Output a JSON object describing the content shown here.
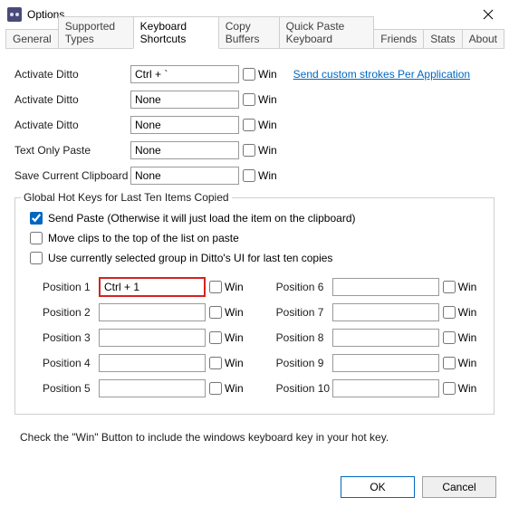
{
  "window": {
    "title": "Options"
  },
  "tabs": [
    {
      "label": "General"
    },
    {
      "label": "Supported Types"
    },
    {
      "label": "Keyboard Shortcuts"
    },
    {
      "label": "Copy Buffers"
    },
    {
      "label": "Quick Paste Keyboard"
    },
    {
      "label": "Friends"
    },
    {
      "label": "Stats"
    },
    {
      "label": "About"
    }
  ],
  "active_tab_index": 2,
  "shortcut_rows": [
    {
      "label": "Activate Ditto",
      "value": "Ctrl + `",
      "win_checked": false
    },
    {
      "label": "Activate Ditto",
      "value": "None",
      "win_checked": false
    },
    {
      "label": "Activate Ditto",
      "value": "None",
      "win_checked": false
    },
    {
      "label": "Text Only Paste",
      "value": "None",
      "win_checked": false
    },
    {
      "label": "Save Current Clipboard",
      "value": "None",
      "win_checked": false
    }
  ],
  "win_label": "Win",
  "link_text": "Send custom strokes Per Application",
  "group": {
    "title": "Global Hot Keys for Last Ten Items Copied",
    "options": [
      {
        "label": "Send Paste (Otherwise it will just load the item on the clipboard)",
        "checked": true
      },
      {
        "label": "Move clips to the top of the list on paste",
        "checked": false
      },
      {
        "label": "Use currently selected group in Ditto's UI for last ten copies",
        "checked": false
      }
    ],
    "positions_left": [
      {
        "label": "Position 1",
        "value": "Ctrl + 1",
        "win_checked": false,
        "highlight": true
      },
      {
        "label": "Position 2",
        "value": "",
        "win_checked": false
      },
      {
        "label": "Position 3",
        "value": "",
        "win_checked": false
      },
      {
        "label": "Position 4",
        "value": "",
        "win_checked": false
      },
      {
        "label": "Position 5",
        "value": "",
        "win_checked": false
      }
    ],
    "positions_right": [
      {
        "label": "Position 6",
        "value": "",
        "win_checked": false
      },
      {
        "label": "Position 7",
        "value": "",
        "win_checked": false
      },
      {
        "label": "Position 8",
        "value": "",
        "win_checked": false
      },
      {
        "label": "Position 9",
        "value": "",
        "win_checked": false
      },
      {
        "label": "Position 10",
        "value": "",
        "win_checked": false
      }
    ]
  },
  "footnote": "Check the \"Win\" Button to include the windows keyboard key in your hot key.",
  "buttons": {
    "ok": "OK",
    "cancel": "Cancel"
  }
}
